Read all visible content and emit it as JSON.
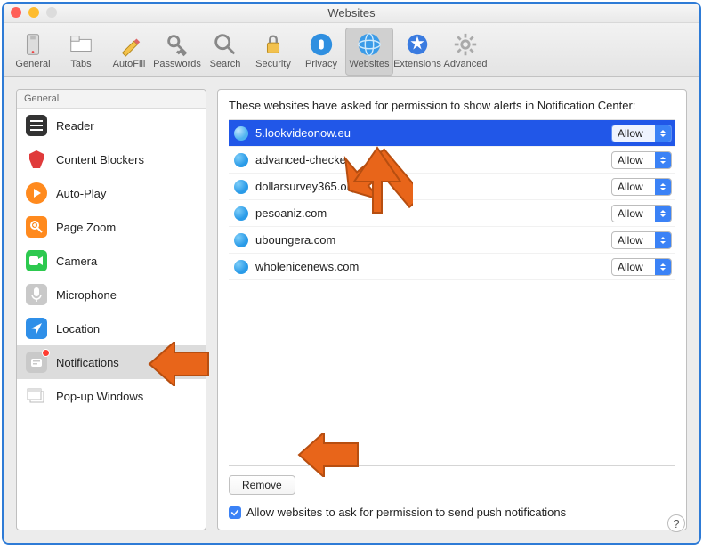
{
  "window": {
    "title": "Websites"
  },
  "traffic_colors": {
    "close": "#ff5f57",
    "min": "#febc2e",
    "max": "#dcdcdc"
  },
  "toolbar": [
    {
      "id": "general",
      "label": "General"
    },
    {
      "id": "tabs",
      "label": "Tabs"
    },
    {
      "id": "autofill",
      "label": "AutoFill"
    },
    {
      "id": "passwords",
      "label": "Passwords"
    },
    {
      "id": "search",
      "label": "Search"
    },
    {
      "id": "security",
      "label": "Security"
    },
    {
      "id": "privacy",
      "label": "Privacy"
    },
    {
      "id": "websites",
      "label": "Websites",
      "selected": true
    },
    {
      "id": "extensions",
      "label": "Extensions"
    },
    {
      "id": "advanced",
      "label": "Advanced"
    }
  ],
  "sidebar": {
    "header": "General",
    "items": [
      {
        "id": "reader",
        "label": "Reader"
      },
      {
        "id": "contentblockers",
        "label": "Content Blockers"
      },
      {
        "id": "autoplay",
        "label": "Auto-Play"
      },
      {
        "id": "pagezoom",
        "label": "Page Zoom"
      },
      {
        "id": "camera",
        "label": "Camera"
      },
      {
        "id": "microphone",
        "label": "Microphone"
      },
      {
        "id": "location",
        "label": "Location"
      },
      {
        "id": "notifications",
        "label": "Notifications",
        "selected": true,
        "badge": true
      },
      {
        "id": "popup",
        "label": "Pop-up Windows"
      }
    ]
  },
  "main": {
    "description": "These websites have asked for permission to show alerts in Notification Center:",
    "sites": [
      {
        "domain": "5.lookvideonow.eu",
        "permission": "Allow",
        "selected": true
      },
      {
        "domain": "advanced-checke",
        "permission": "Allow"
      },
      {
        "domain": "dollarsurvey365.org",
        "permission": "Allow"
      },
      {
        "domain": "pesoaniz.com",
        "permission": "Allow"
      },
      {
        "domain": "uboungera.com",
        "permission": "Allow"
      },
      {
        "domain": "wholenicenews.com",
        "permission": "Allow"
      }
    ],
    "remove_label": "Remove",
    "checkbox_label": "Allow websites to ask for permission to send push notifications",
    "checkbox_checked": true
  },
  "help_label": "?"
}
